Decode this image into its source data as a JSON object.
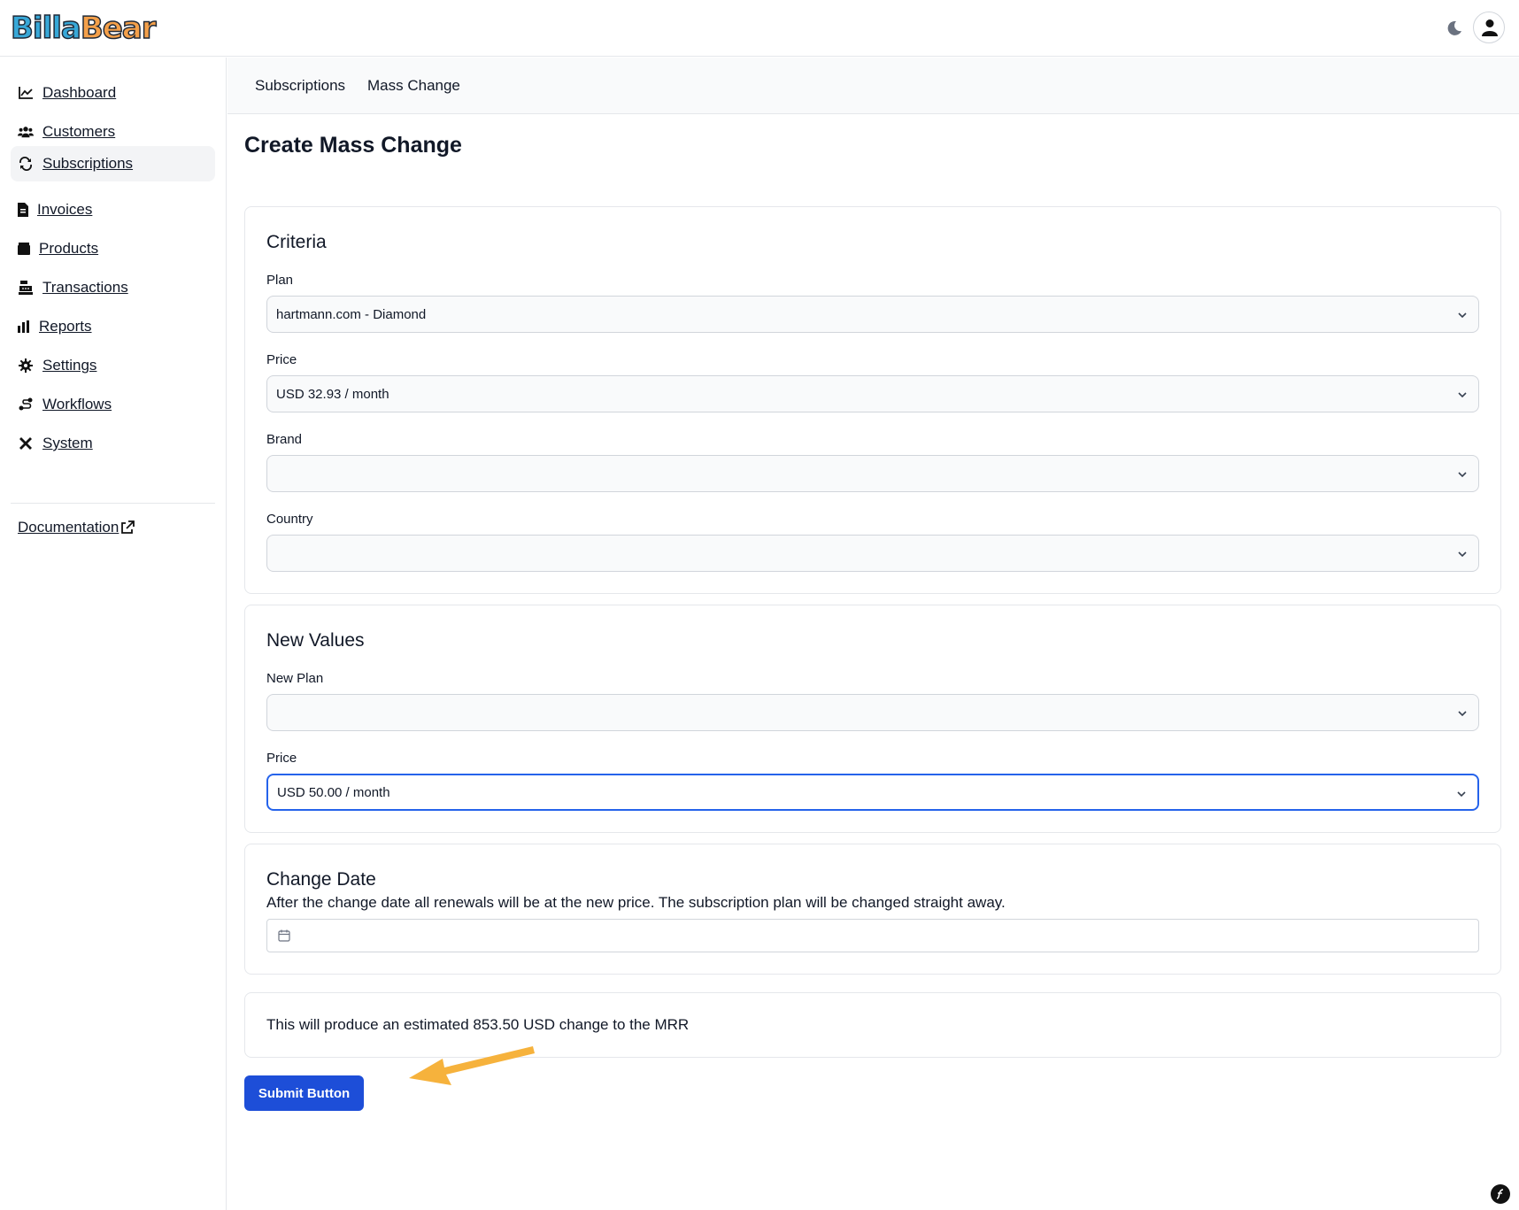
{
  "app": {
    "logo_part1": "Billa",
    "logo_part2": "Bear"
  },
  "sidebar": {
    "items": [
      {
        "label": "Dashboard",
        "icon": "chart-line-icon"
      },
      {
        "label": "Customers",
        "icon": "users-icon"
      },
      {
        "label": "Subscriptions",
        "icon": "repeat-icon"
      },
      {
        "label": "Invoices",
        "icon": "file-invoice-icon"
      },
      {
        "label": "Products",
        "icon": "box-icon"
      },
      {
        "label": "Transactions",
        "icon": "cash-register-icon"
      },
      {
        "label": "Reports",
        "icon": "bar-chart-icon"
      },
      {
        "label": "Settings",
        "icon": "gear-icon"
      },
      {
        "label": "Workflows",
        "icon": "route-icon"
      },
      {
        "label": "System",
        "icon": "tools-icon"
      }
    ],
    "active": "Subscriptions",
    "documentation": "Documentation"
  },
  "subnav": {
    "subscriptions": "Subscriptions",
    "mass_change": "Mass Change"
  },
  "page": {
    "title": "Create Mass Change"
  },
  "criteria": {
    "title": "Criteria",
    "plan_label": "Plan",
    "plan_value": "hartmann.com - Diamond",
    "price_label": "Price",
    "price_value": "USD 32.93 / month",
    "brand_label": "Brand",
    "brand_value": "",
    "country_label": "Country",
    "country_value": ""
  },
  "new_values": {
    "title": "New Values",
    "plan_label": "New Plan",
    "plan_value": "",
    "price_label": "Price",
    "price_value": "USD 50.00 / month"
  },
  "change_date": {
    "title": "Change Date",
    "description": "After the change date all renewals will be at the new price. The subscription plan will be changed straight away.",
    "value": ""
  },
  "estimate": {
    "text": "This will produce an estimated 853.50 USD change to the MRR"
  },
  "submit_label": "Submit Button",
  "colors": {
    "primary": "#1d4ed8",
    "focus": "#2563eb",
    "arrow": "#f6b23c"
  }
}
